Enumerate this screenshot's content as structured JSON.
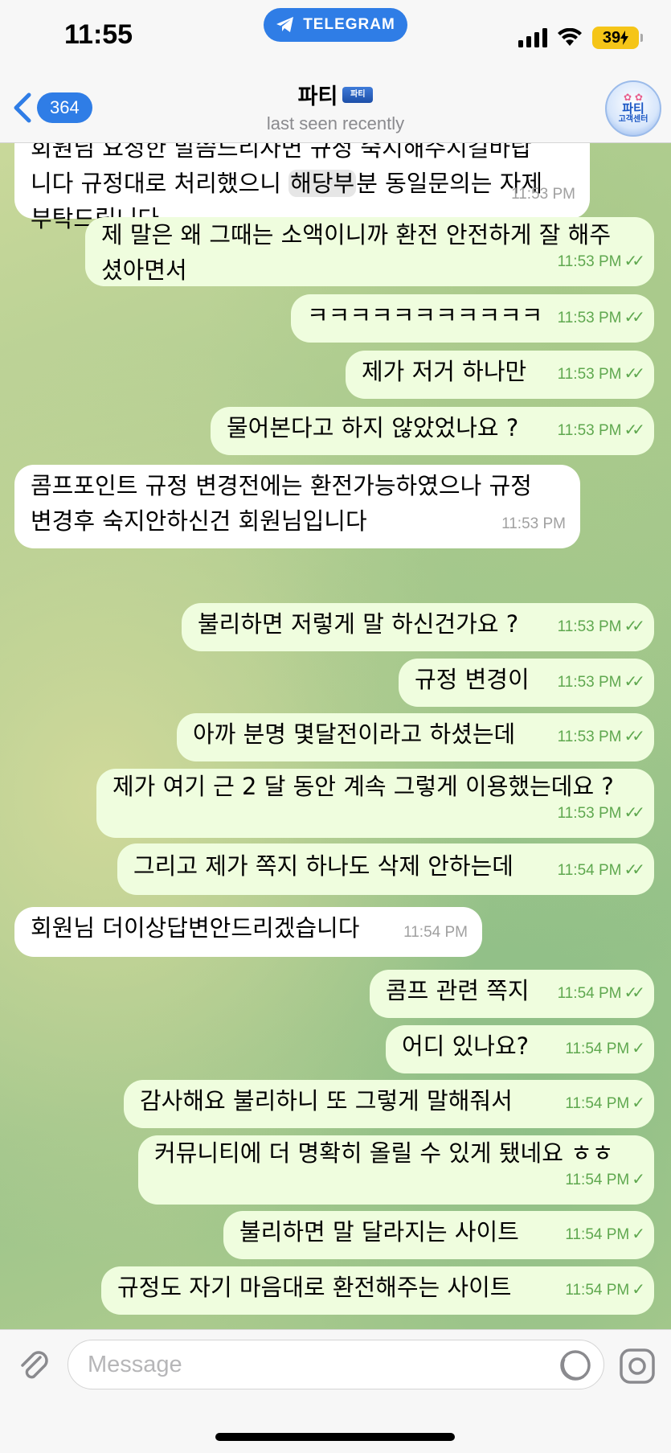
{
  "status_bar": {
    "time": "11:55",
    "app_pill": "TELEGRAM",
    "battery": "39"
  },
  "header": {
    "back_count": "364",
    "title": "파티",
    "title_emblem": "파티",
    "subtitle": "last seen recently",
    "avatar_line1": "파티",
    "avatar_line2": "고객센터"
  },
  "messages": [
    {
      "dir": "in",
      "lines": [
        "회원님 요청한 말씀드리자면 규정 숙지해주시길바랍",
        "니다 규정대로 처리했으니 ",
        "부탁드립니다"
      ],
      "highlight": "해당부",
      "line2_tail": "분 동일문의는 자제",
      "time": "11:53 PM"
    },
    {
      "dir": "out",
      "lines": [
        "제 말은 왜 그때는 소액이니까 환전 안전하게 잘 해주",
        "셨아면서"
      ],
      "time": "11:53 PM",
      "status": "read"
    },
    {
      "dir": "out",
      "text": "ㅋㅋㅋㅋㅋㅋㅋㅋㅋㅋㅋ",
      "time": "11:53 PM",
      "status": "read"
    },
    {
      "dir": "out",
      "text": "제가 저거 하나만",
      "time": "11:53 PM",
      "status": "read"
    },
    {
      "dir": "out",
      "text": "물어본다고 하지 않았었나요 ?",
      "time": "11:53 PM",
      "status": "read"
    },
    {
      "dir": "in",
      "lines": [
        "콤프포인트 규정 변경전에는 환전가능하였으나 규정",
        "변경후 숙지안하신건 회원님입니다"
      ],
      "time": "11:53 PM"
    },
    {
      "dir": "out",
      "text": "불리하면 저렇게 말 하신건가요 ?",
      "time": "11:53 PM",
      "status": "read"
    },
    {
      "dir": "out",
      "text": "규정 변경이",
      "time": "11:53 PM",
      "status": "read"
    },
    {
      "dir": "out",
      "text": "아까 분명 몇달전이라고 하셨는데",
      "time": "11:53 PM",
      "status": "read"
    },
    {
      "dir": "out",
      "lines": [
        "제가 여기 근 2 달 동안 계속 그렇게 이용했는데요 ?"
      ],
      "time": "11:53 PM",
      "status": "read"
    },
    {
      "dir": "out",
      "text": "그리고 제가 쪽지 하나도 삭제 안하는데",
      "time": "11:54 PM",
      "status": "read"
    },
    {
      "dir": "in",
      "text": "회원님 더이상답변안드리겠습니다",
      "time": "11:54 PM"
    },
    {
      "dir": "out",
      "text": "콤프 관련 쪽지",
      "time": "11:54 PM",
      "status": "read"
    },
    {
      "dir": "out",
      "text": "어디 있나요?",
      "time": "11:54 PM",
      "status": "sent"
    },
    {
      "dir": "out",
      "text": "감사해요 불리하니 또 그렇게 말해줘서",
      "time": "11:54 PM",
      "status": "sent"
    },
    {
      "dir": "out",
      "lines": [
        "커뮤니티에 더 명확히 올릴 수 있게 됐네요 ㅎㅎ"
      ],
      "time": "11:54 PM",
      "status": "sent"
    },
    {
      "dir": "out",
      "text": "불리하면 말 달라지는 사이트",
      "time": "11:54 PM",
      "status": "sent"
    },
    {
      "dir": "out",
      "text": "규정도 자기 마음대로 환전해주는 사이트",
      "time": "11:54 PM",
      "status": "sent"
    }
  ],
  "input": {
    "placeholder": "Message"
  }
}
